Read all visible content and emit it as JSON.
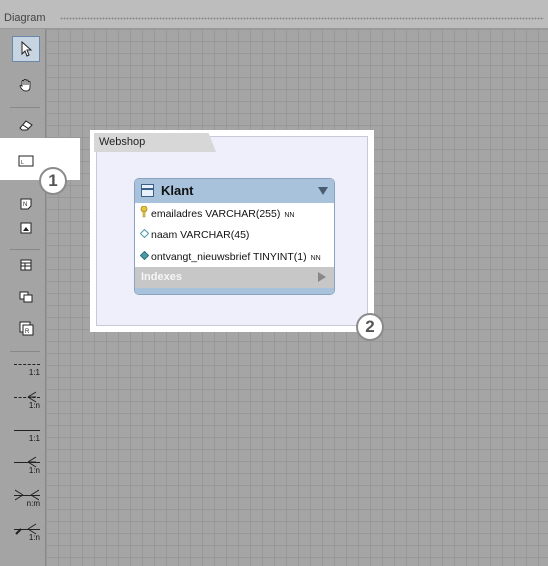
{
  "window": {
    "title": "Diagram"
  },
  "toolbar": {
    "tools": [
      {
        "name": "select-tool",
        "icon": "pointer-icon"
      },
      {
        "name": "hand-tool",
        "icon": "hand-icon"
      },
      {
        "name": "eraser-tool",
        "icon": "eraser-icon"
      },
      {
        "name": "layer-tool",
        "icon": "layer-icon",
        "selected": true
      },
      {
        "name": "text-tool",
        "icon": "note-icon"
      },
      {
        "name": "image-tool",
        "icon": "image-icon"
      },
      {
        "name": "table-tool",
        "icon": "table-icon"
      },
      {
        "name": "view-tool",
        "icon": "view-icon"
      },
      {
        "name": "routine-group-tool",
        "icon": "routine-group-icon"
      }
    ],
    "relationships": [
      {
        "label": "1:1",
        "style": "dashed"
      },
      {
        "label": "1:n",
        "style": "dashed"
      },
      {
        "label": "1:1",
        "style": "solid"
      },
      {
        "label": "1:n",
        "style": "solid"
      },
      {
        "label": "n:m",
        "style": "solid"
      },
      {
        "label": "1:n",
        "style": "existing-columns"
      }
    ]
  },
  "callouts": {
    "one": "1",
    "two": "2"
  },
  "layer": {
    "name": "Webshop"
  },
  "table": {
    "name": "Klant",
    "columns": [
      {
        "text": "emailadres VARCHAR(255)",
        "flag": "NN",
        "icon": "primary-key-icon"
      },
      {
        "text": "naam VARCHAR(45)",
        "flag": "",
        "icon": "nullable-column-icon"
      },
      {
        "text": "ontvangt_nieuwsbrief TINYINT(1)",
        "flag": "NN",
        "icon": "not-null-column-icon"
      }
    ],
    "indexes_label": "Indexes"
  },
  "colors": {
    "table_header": "#a9c2db",
    "layer_fill": "#efeffb",
    "selected_tool": "#c7d4e2"
  }
}
